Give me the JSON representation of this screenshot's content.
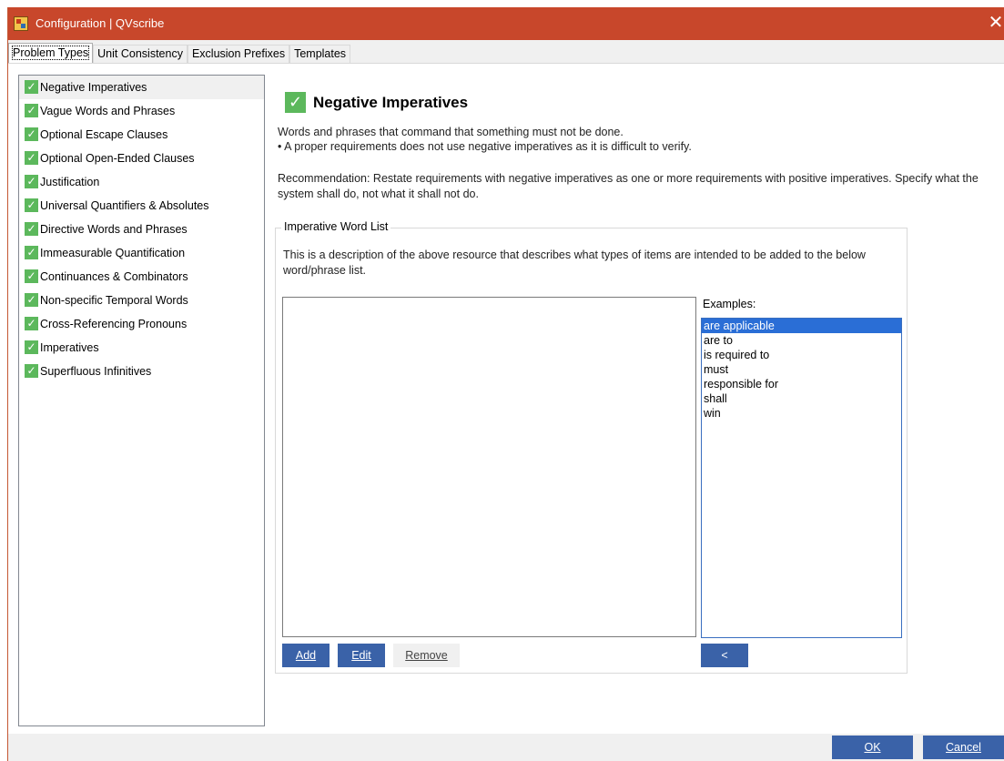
{
  "window": {
    "title": "Configuration | QVscribe",
    "close_glyph": "✕",
    "accent_color": "#c8472b"
  },
  "tabs": [
    {
      "label": "Problem Types",
      "active": true
    },
    {
      "label": "Unit Consistency",
      "active": false
    },
    {
      "label": "Exclusion Prefixes",
      "active": false
    },
    {
      "label": "Templates",
      "active": false
    }
  ],
  "problem_types": [
    {
      "label": "Negative Imperatives",
      "checked": true,
      "selected": true
    },
    {
      "label": "Vague Words and Phrases",
      "checked": true
    },
    {
      "label": "Optional Escape Clauses",
      "checked": true
    },
    {
      "label": "Optional Open-Ended Clauses",
      "checked": true
    },
    {
      "label": "Justification",
      "checked": true
    },
    {
      "label": "Universal Quantifiers & Absolutes",
      "checked": true
    },
    {
      "label": "Directive Words and Phrases",
      "checked": true
    },
    {
      "label": "Immeasurable Quantification",
      "checked": true
    },
    {
      "label": "Continuances & Combinators",
      "checked": true
    },
    {
      "label": "Non-specific Temporal Words",
      "checked": true
    },
    {
      "label": "Cross-Referencing Pronouns",
      "checked": true
    },
    {
      "label": "Imperatives",
      "checked": true
    },
    {
      "label": "Superfluous Infinitives",
      "checked": true
    }
  ],
  "detail": {
    "title": "Negative Imperatives",
    "description_line1": "Words and phrases that command that something must not be done.",
    "description_line2": "• A proper requirements does not use negative imperatives as it is difficult to verify.",
    "recommendation": "Recommendation: Restate requirements with negative imperatives as one or more requirements with positive imperatives. Specify what the system shall do, not what it shall not do.",
    "check_color": "#5cb85c"
  },
  "word_list_group": {
    "legend": "Imperative Word List",
    "description": "This is a description of the above resource that describes what types of items are intended to be added to the below word/phrase list.",
    "items": [],
    "examples_label": "Examples:",
    "examples": [
      {
        "text": "are applicable",
        "selected": true
      },
      {
        "text": "are to"
      },
      {
        "text": "is required to"
      },
      {
        "text": "must"
      },
      {
        "text": "responsible for"
      },
      {
        "text": "shall"
      },
      {
        "text": "win"
      }
    ],
    "buttons": {
      "add": "Add",
      "edit": "Edit",
      "remove": "Remove",
      "copy_example": "<"
    }
  },
  "footer": {
    "ok": "OK",
    "cancel": "Cancel",
    "button_color": "#3a62a8"
  }
}
